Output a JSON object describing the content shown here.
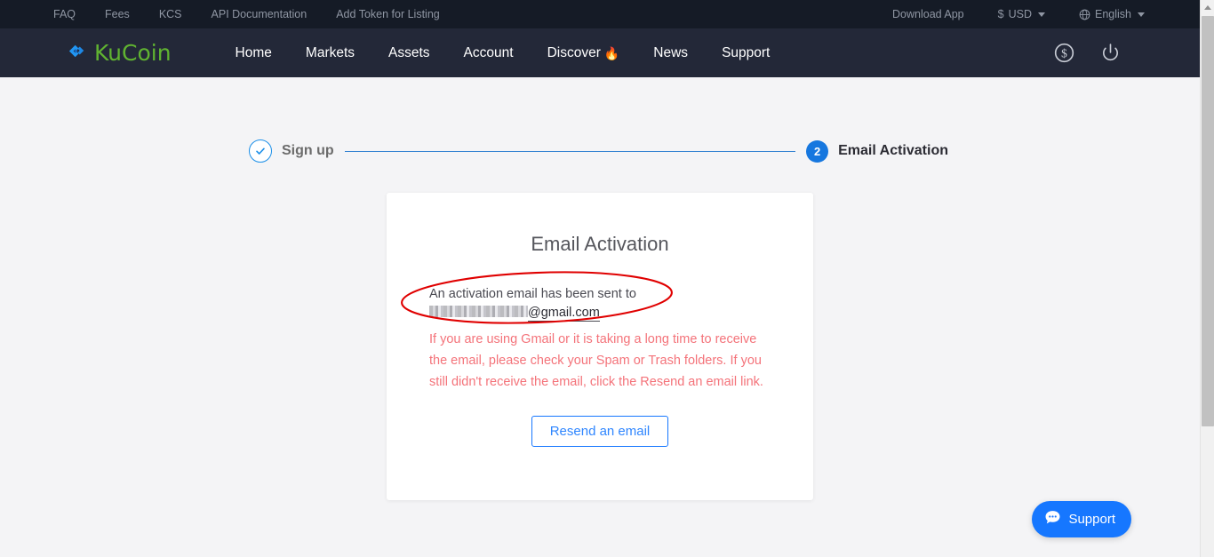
{
  "topbar": {
    "links": [
      {
        "label": "FAQ",
        "name": "faq"
      },
      {
        "label": "Fees",
        "name": "fees"
      },
      {
        "label": "KCS",
        "name": "kcs"
      },
      {
        "label": "API Documentation",
        "name": "api-documentation"
      },
      {
        "label": "Add Token for Listing",
        "name": "add-token-for-listing"
      }
    ],
    "download_app": "Download App",
    "currency_symbol": "$",
    "currency": "USD",
    "language": "English",
    "globe_icon": "globe-icon",
    "caret_icon": "chevron-down-icon"
  },
  "nav": {
    "logo_text": "KuCoin",
    "logo_icon": "kucoin-k-logo-icon",
    "links": [
      {
        "label": "Home",
        "name": "home"
      },
      {
        "label": "Markets",
        "name": "markets"
      },
      {
        "label": "Assets",
        "name": "assets"
      },
      {
        "label": "Account",
        "name": "account"
      },
      {
        "label": "Discover",
        "name": "discover",
        "badge": "🔥"
      },
      {
        "label": "News",
        "name": "news"
      },
      {
        "label": "Support",
        "name": "support"
      }
    ],
    "icons": [
      {
        "name": "dollar-circle-icon"
      },
      {
        "name": "power-logout-icon"
      }
    ]
  },
  "stepper": {
    "step1": {
      "label": "Sign up",
      "state": "completed",
      "icon": "check-icon"
    },
    "step2": {
      "label": "Email Activation",
      "number": "2",
      "state": "active"
    }
  },
  "card": {
    "title": "Email Activation",
    "sent_message": "An activation email has been sent to",
    "email_redacted": "███████████",
    "email_domain": "@gmail.com",
    "warning": "If you are using Gmail or it is taking a long time to receive the email, please check your Spam or Trash folders. If you still didn't receive the email, click the Resend an email link.",
    "resend_label": "Resend an email"
  },
  "annotation": {
    "shape": "ellipse",
    "color": "#e00000",
    "target": "An activation email has been sent to @gmail.com"
  },
  "support_widget": {
    "label": "Support",
    "icon": "chat-bubble-icon"
  },
  "scrollbar": {
    "up_arrow_icon": "scroll-up-arrow-icon"
  },
  "colors": {
    "topbar_bg": "#151b26",
    "nav_bg": "#232838",
    "page_bg": "#f4f4f6",
    "brand_green": "#60b331",
    "brand_blue": "#1677ff",
    "warning_red": "#f4737a",
    "annotation_red": "#e00000"
  }
}
